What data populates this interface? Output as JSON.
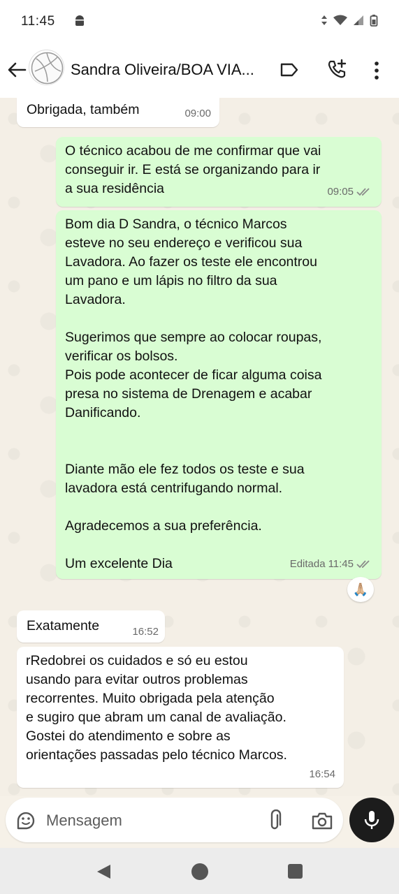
{
  "status_bar": {
    "time": "11:45"
  },
  "header": {
    "contact_name": "Sandra Oliveira/BOA VIA..."
  },
  "messages": [
    {
      "direction": "in",
      "text": "Obrigada,  também",
      "time": "09:00"
    },
    {
      "direction": "out",
      "text": "O técnico acabou de me confirmar que vai\nconseguir ir. E está se organizando para ir\na sua residência",
      "time": "09:05",
      "status": "read"
    },
    {
      "direction": "out",
      "text": "Bom dia D Sandra, o técnico Marcos\nesteve no seu endereço e verificou sua\nLavadora.  Ao fazer os teste ele encontrou\num pano e um lápis no filtro da sua\nLavadora.\n\nSugerimos que sempre ao colocar roupas,\nverificar os bolsos.\nPois pode acontecer de ficar alguma coisa\npresa no sistema de Drenagem e acabar\nDanificando.\n\n\nDiante mão ele fez todos os teste e sua\nlavadora está centrifugando normal.\n\nAgradecemos a sua preferência.\n\nUm excelente Dia",
      "edited_label": "Editada",
      "time": "11:45",
      "status": "read",
      "reaction": "🙏🏼"
    },
    {
      "direction": "in",
      "text": "Exatamente",
      "time": "16:52"
    },
    {
      "direction": "in",
      "text": "rRedobrei os cuidados e só eu estou\nusando para evitar outros problemas\nrecorrentes.  Muito obrigada pela atenção\ne sugiro que abram um canal de avaliação.\nGostei do atendimento e sobre as\norientações passadas pelo técnico Marcos.",
      "time": "16:54"
    }
  ],
  "composer": {
    "placeholder": "Mensagem"
  },
  "colors": {
    "incoming_bubble": "#ffffff",
    "outgoing_bubble": "#d9fdd3",
    "chat_background": "#f4efe6",
    "mic_button": "#1c1c1c"
  },
  "icons": {
    "back": "arrow-left-icon",
    "label": "label-tag-icon",
    "call": "add-call-icon",
    "menu": "more-vertical-icon",
    "emoji": "emoji-sticker-icon",
    "attach": "paperclip-icon",
    "camera": "camera-icon",
    "mic": "microphone-icon",
    "ticks": "double-check-icon"
  }
}
